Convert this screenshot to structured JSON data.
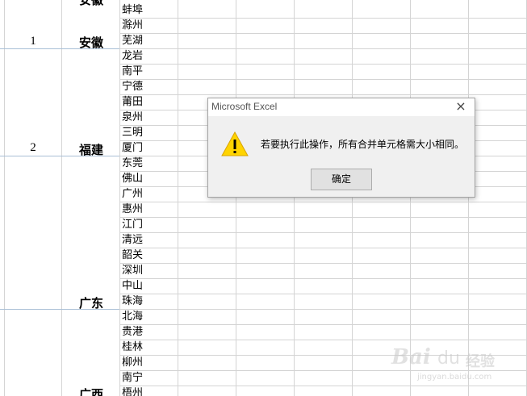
{
  "sheet": {
    "rows": [
      {
        "num": "1",
        "province": "安徽"
      },
      {
        "num": "2",
        "province": "福建"
      },
      {
        "num": "",
        "province": "广东"
      },
      {
        "num": "",
        "province": "广西"
      }
    ],
    "cities": [
      "蚌埠",
      "滁州",
      "芜湖",
      "龙岩",
      "南平",
      "宁德",
      "莆田",
      "泉州",
      "三明",
      "厦门",
      "东莞",
      "佛山",
      "广州",
      "惠州",
      "江门",
      "清远",
      "韶关",
      "深圳",
      "中山",
      "珠海",
      "北海",
      "贵港",
      "桂林",
      "柳州",
      "南宁",
      "梧州"
    ]
  },
  "dialog": {
    "title": "Microsoft Excel",
    "close_icon": "×",
    "warning_icon": "warning-triangle-icon",
    "message": "若要执行此操作，所有合并单元格需大小相同。",
    "ok_label": "确定"
  },
  "watermark": {
    "logo": "Bai",
    "paw": "du",
    "text": "经验",
    "url": "jingyan.baidu.com"
  },
  "colors": {
    "gridline": "#d4d4d4",
    "merge_border": "#a9bfd6",
    "dialog_bg": "#f0f0f0",
    "warning": "#ffd400"
  }
}
